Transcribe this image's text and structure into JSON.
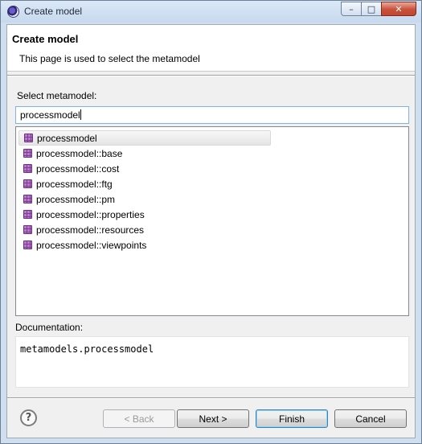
{
  "window": {
    "title": "Create model",
    "minimize_glyph": "–",
    "maximize_glyph": "□",
    "close_glyph": "✕"
  },
  "header": {
    "title": "Create model",
    "description": "This page is used to select the metamodel"
  },
  "select": {
    "label": "Select metamodel:",
    "filter_value": "processmodel"
  },
  "metamodels": {
    "selected_index": 0,
    "items": [
      "processmodel",
      "processmodel::base",
      "processmodel::cost",
      "processmodel::ftg",
      "processmodel::pm",
      "processmodel::properties",
      "processmodel::resources",
      "processmodel::viewpoints"
    ]
  },
  "documentation": {
    "label": "Documentation:",
    "text": "metamodels.processmodel"
  },
  "buttons": {
    "help": "?",
    "back": "< Back",
    "next": "Next >",
    "finish": "Finish",
    "cancel": "Cancel",
    "back_enabled": false
  },
  "icons": {
    "app": "eclipse-icon",
    "package": "package-icon",
    "help": "help-icon"
  }
}
